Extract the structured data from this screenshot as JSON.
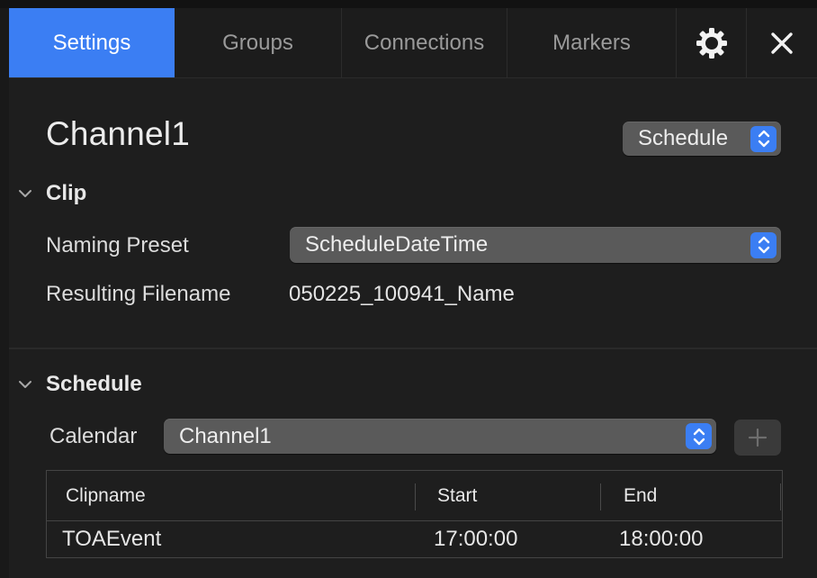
{
  "tabs": [
    {
      "label": "Settings",
      "active": true
    },
    {
      "label": "Groups",
      "active": false
    },
    {
      "label": "Connections",
      "active": false
    },
    {
      "label": "Markers",
      "active": false
    }
  ],
  "toolbar_icons": {
    "settings": "gear-icon",
    "close": "close-icon"
  },
  "channel": {
    "title": "Channel1",
    "mode_popup": "Schedule"
  },
  "clip_section": {
    "heading": "Clip",
    "naming_preset_label": "Naming Preset",
    "naming_preset_value": "ScheduleDateTime",
    "resulting_filename_label": "Resulting Filename",
    "resulting_filename_value": "050225_100941_Name"
  },
  "schedule_section": {
    "heading": "Schedule",
    "calendar_label": "Calendar",
    "calendar_value": "Channel1",
    "add_button": "+"
  },
  "table": {
    "columns": [
      "Clipname",
      "Start",
      "End"
    ],
    "rows": [
      {
        "clipname": "TOAEvent",
        "start": "17:00:00",
        "end": "18:00:00"
      }
    ]
  },
  "colors": {
    "accent": "#3b7ef3",
    "background": "#1e1e1e",
    "popup": "#5a5a5a"
  }
}
